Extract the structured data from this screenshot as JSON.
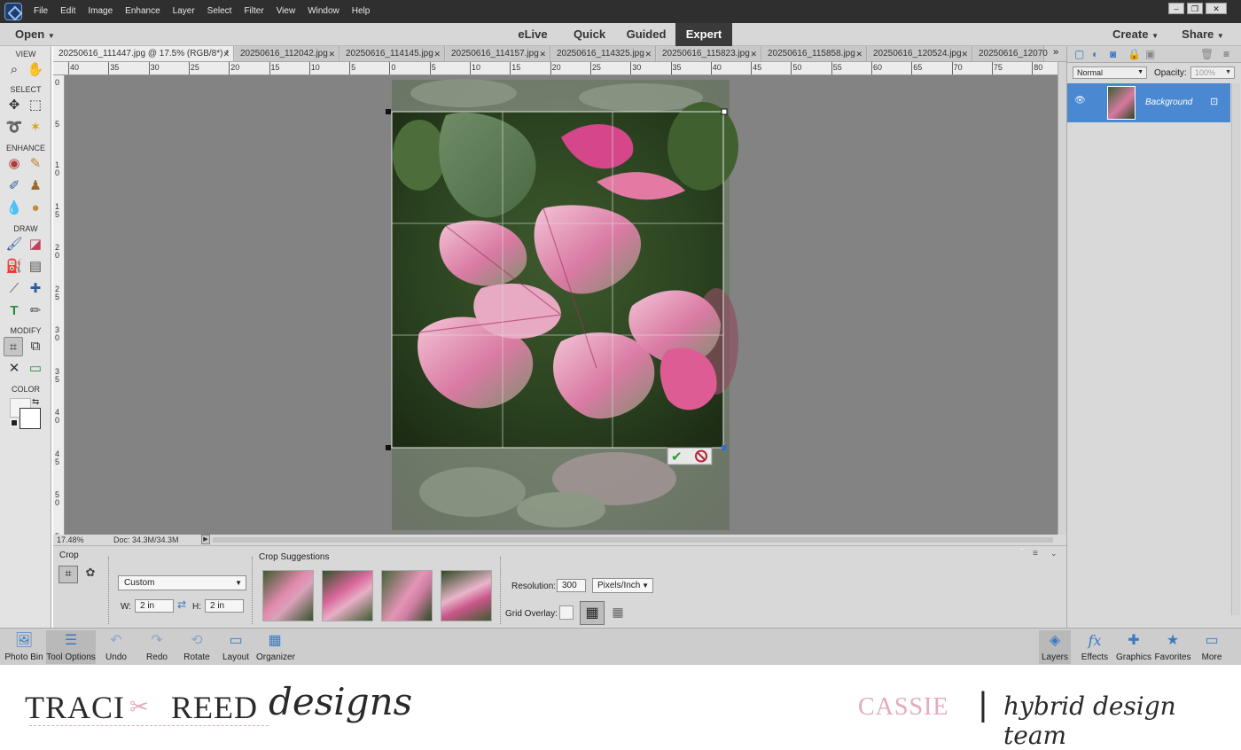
{
  "menubar": {
    "items": [
      "File",
      "Edit",
      "Image",
      "Enhance",
      "Layer",
      "Select",
      "Filter",
      "View",
      "Window",
      "Help"
    ],
    "window_controls": [
      "–",
      "❐",
      "✕"
    ]
  },
  "modebar": {
    "open_label": "Open",
    "modes": [
      "eLive",
      "Quick",
      "Guided",
      "Expert"
    ],
    "active_mode": "Expert",
    "create_label": "Create",
    "share_label": "Share"
  },
  "tabs": [
    {
      "label": "20250616_111447.jpg @ 17.5% (RGB/8*) *",
      "active": true
    },
    {
      "label": "20250616_112042.jpg"
    },
    {
      "label": "20250616_114145.jpg"
    },
    {
      "label": "20250616_114157.jpg"
    },
    {
      "label": "20250616_114325.jpg"
    },
    {
      "label": "20250616_115823.jpg"
    },
    {
      "label": "20250616_115858.jpg"
    },
    {
      "label": "20250616_120524.jpg"
    },
    {
      "label": "20250616_12070"
    }
  ],
  "tabs_overflow": "»",
  "ruler_h": [
    "40",
    "35",
    "30",
    "25",
    "20",
    "15",
    "10",
    "5",
    "0",
    "5",
    "10",
    "15",
    "20",
    "25",
    "30",
    "35",
    "40",
    "45",
    "50",
    "55",
    "60",
    "65",
    "70",
    "75",
    "80"
  ],
  "ruler_v": [
    "0",
    "5",
    "1 0",
    "1 5",
    "2 0",
    "2 5",
    "3 0",
    "3 5",
    "4 0",
    "4 5",
    "5 0",
    "5"
  ],
  "toolbox": {
    "sections": [
      "VIEW",
      "SELECT",
      "ENHANCE",
      "DRAW",
      "MODIFY",
      "COLOR"
    ]
  },
  "status": {
    "zoom": "17.48%",
    "doc": "Doc: 34.3M/34.3M"
  },
  "layers": {
    "blend_mode": "Normal",
    "opacity_label": "Opacity:",
    "opacity_value": "100%",
    "layer_name": "Background"
  },
  "tool_options": {
    "tool_name": "Crop",
    "preset": "Custom",
    "w_label": "W:",
    "w_value": "2 in",
    "h_label": "H:",
    "h_value": "2 in",
    "suggestions_label": "Crop Suggestions",
    "resolution_label": "Resolution:",
    "resolution_value": "300",
    "resolution_unit": "Pixels/Inch",
    "grid_overlay_label": "Grid Overlay:"
  },
  "taskbar": {
    "left": [
      "Photo Bin",
      "Tool Options",
      "Undo",
      "Redo",
      "Rotate",
      "Layout",
      "Organizer"
    ],
    "right": [
      "Layers",
      "Effects",
      "Graphics",
      "Favorites",
      "More"
    ]
  },
  "footer": {
    "brand_caps": "TRACI",
    "brand_caps2": "REED",
    "brand_script": "designs",
    "name": "CASSIE",
    "divider": "|",
    "team": "hybrid design team"
  },
  "colors": {
    "accent": "#3b79c4",
    "pink": "#e3aac0",
    "brand_dark": "#2a2a2a"
  }
}
